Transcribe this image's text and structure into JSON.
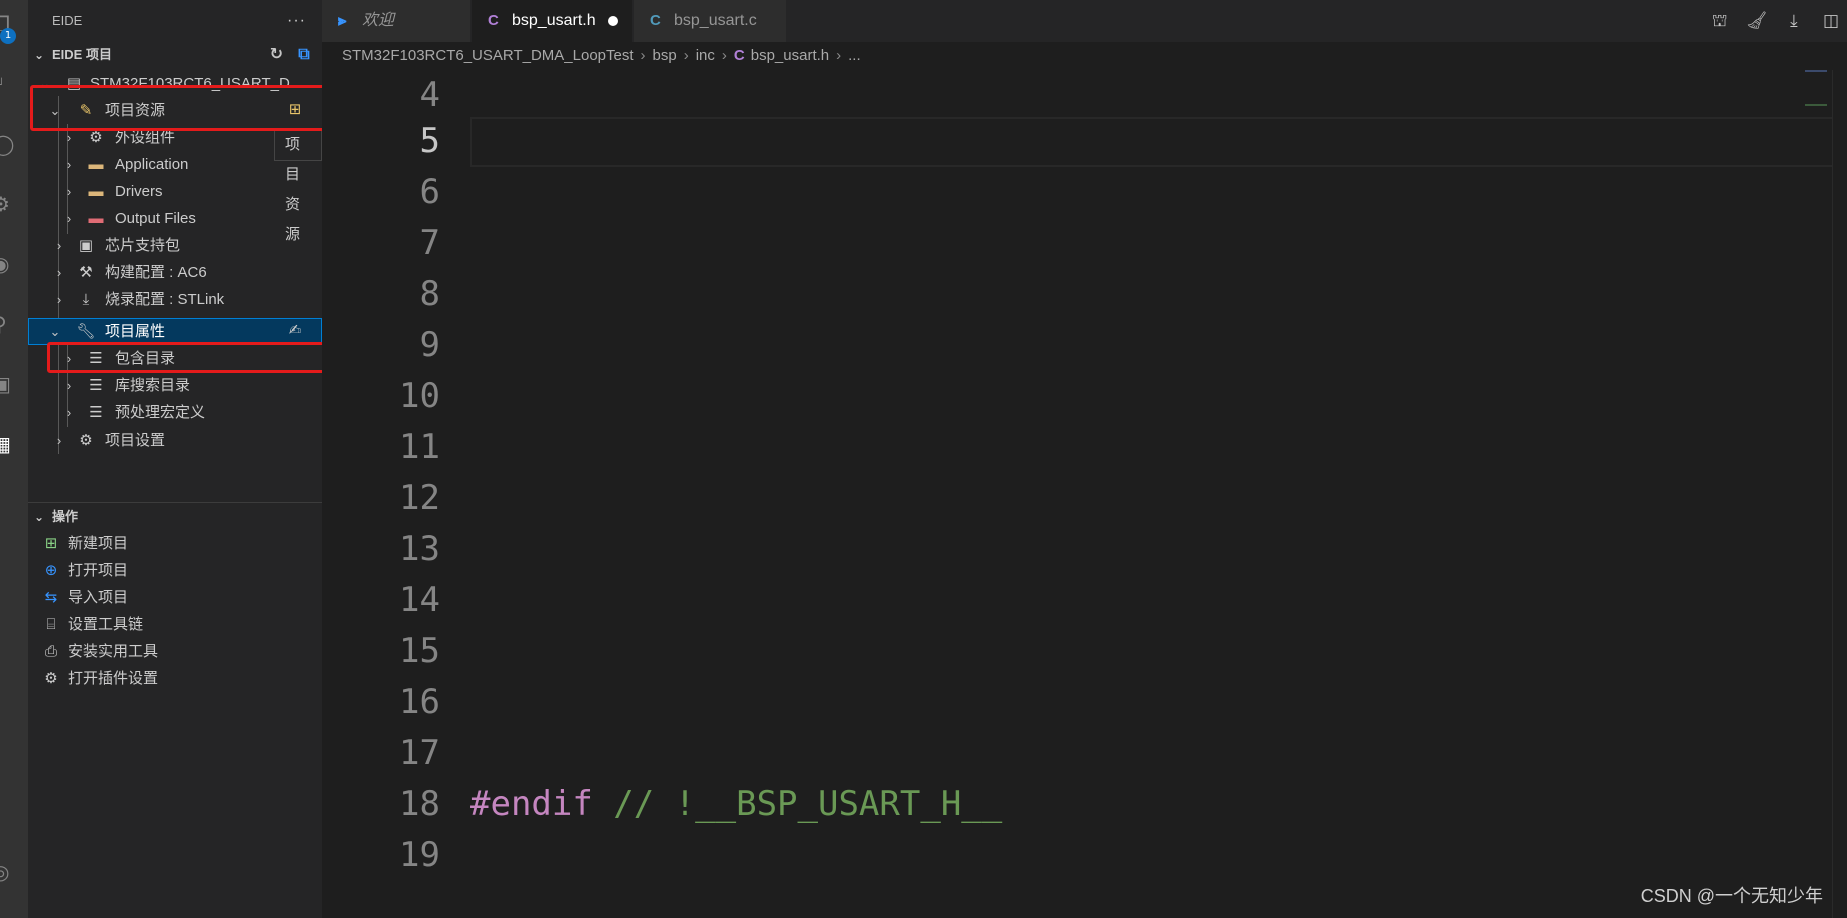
{
  "sidebar": {
    "title": "EIDE",
    "more": "···",
    "project_section": "EIDE 项目",
    "project_root": "STM32F103RCT6_USART_D...",
    "tree": {
      "resources": "项目资源",
      "peripherals": "外设组件",
      "application": "Application",
      "drivers": "Drivers",
      "output_files": "Output Files",
      "chip_pkg": "芯片支持包",
      "build_config": "构建配置 : AC6",
      "flash_config": "烧录配置 : STLink",
      "properties": "项目属性",
      "include_dirs": "包含目录",
      "lib_dirs": "库搜索目录",
      "macros": "预处理宏定义",
      "settings": "项目设置"
    },
    "tooltip": "项目资源",
    "ops_section": "操作",
    "ops": [
      {
        "label": "新建项目"
      },
      {
        "label": "打开项目"
      },
      {
        "label": "导入项目"
      },
      {
        "label": "设置工具链"
      },
      {
        "label": "安装实用工具"
      },
      {
        "label": "打开插件设置"
      }
    ]
  },
  "activity": {
    "badge": "1"
  },
  "tabs": [
    {
      "label": "欢迎",
      "icon": "vscode-icon"
    },
    {
      "label": "bsp_usart.h",
      "icon": "C",
      "dirty": true
    },
    {
      "label": "bsp_usart.c",
      "icon": "C"
    }
  ],
  "breadcrumb": {
    "items": [
      "STM32F103RCT6_USART_DMA_LoopTest",
      "bsp",
      "inc",
      "bsp_usart.h",
      "..."
    ],
    "file_icon": "C"
  },
  "editor": {
    "line_numbers": [
      "4",
      "5",
      "6",
      "7",
      "8",
      "9",
      "10",
      "11",
      "12",
      "13",
      "14",
      "15",
      "16",
      "17",
      "18",
      "19"
    ],
    "current_line": "5",
    "code_directive": "#endif",
    "code_comment": " // !__BSP_USART_H__"
  },
  "watermark": "CSDN @一个无知少年",
  "colors": {
    "selection": "#04395e",
    "annotation_red": "#e41b1b",
    "accent": "#007fd4"
  }
}
